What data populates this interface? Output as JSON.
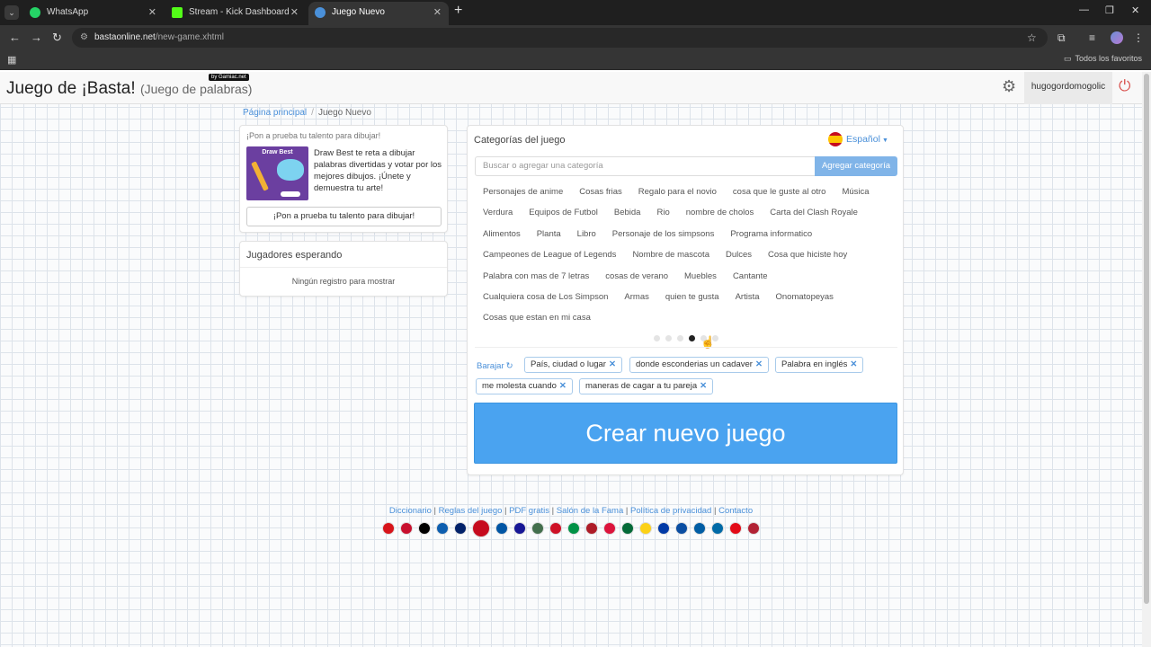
{
  "browser": {
    "tabs": [
      {
        "title": "WhatsApp",
        "icon": "whatsapp-icon",
        "color": "#25d366"
      },
      {
        "title": "Stream - Kick Dashboard",
        "icon": "kick-icon",
        "color": "#53fc18"
      },
      {
        "title": "Juego Nuevo",
        "icon": "globe-icon",
        "color": "#4a90d9"
      }
    ],
    "url_host": "bastaonline.net",
    "url_path": "/new-game.xhtml",
    "bookmarks_folder": "Todos los favoritos"
  },
  "header": {
    "title": "Juego de ¡Basta!",
    "subtitle": "(Juego de palabras)",
    "badge": "by Gamiac.net",
    "username": "hugogordomogolic"
  },
  "breadcrumb": {
    "home": "Página principal",
    "current": "Juego Nuevo"
  },
  "promo": {
    "heading": "¡Pon a prueba tu talento para dibujar!",
    "image_title": "Draw Best",
    "text": "Draw Best te reta a dibujar palabras divertidas y votar por los mejores dibujos. ¡Únete y demuestra tu arte!",
    "button": "¡Pon a prueba tu talento para dibujar!"
  },
  "waiting": {
    "title": "Jugadores esperando",
    "empty": "Ningún registro para mostrar"
  },
  "categories": {
    "title": "Categorías del juego",
    "language": "Español",
    "search_placeholder": "Buscar o agregar una categoría",
    "add_button": "Agregar categoría",
    "rows": [
      [
        "Personajes de anime",
        "Cosas frias",
        "Regalo para el novio",
        "cosa que le guste al otro",
        "Música"
      ],
      [
        "Verdura",
        "Equipos de Futbol",
        "Bebida",
        "Rio",
        "nombre de cholos",
        "Carta del Clash Royale"
      ],
      [
        "Alimentos",
        "Planta",
        "Libro",
        "Personaje de los simpsons",
        "Programa informatico"
      ],
      [
        "Campeones de League of Legends",
        "Nombre de mascota",
        "Dulces",
        "Cosa que hiciste hoy"
      ],
      [
        "Palabra con mas de 7 letras",
        "cosas de verano",
        "Muebles",
        "Cantante"
      ],
      [
        "Cualquiera cosa de Los Simpson",
        "Armas",
        "quien te gusta",
        "Artista",
        "Onomatopeyas"
      ],
      [
        "Cosas que estan en mi casa"
      ]
    ],
    "pages": 6,
    "active_page": 4,
    "shuffle": "Barajar",
    "selected": [
      "País, ciudad o lugar",
      "donde esconderias un cadaver",
      "Palabra en inglés",
      "me molesta cuando",
      "maneras de cagar a tu pareja"
    ],
    "create_button": "Crear nuevo juego"
  },
  "footer": {
    "links": [
      "Diccionario",
      "Reglas del juego",
      "PDF gratis",
      "Salón de la Fama",
      "Política de privacidad",
      "Contacto"
    ],
    "flag_colors": [
      "#d7141a",
      "#c8102e",
      "#000000",
      "#0d5eaf",
      "#012169",
      "#c60b1e",
      "#0055a4",
      "#171796",
      "#436f4d",
      "#ce1126",
      "#009246",
      "#ae1c28",
      "#dc143c",
      "#046a38",
      "#fcd116",
      "#0039a6",
      "#0b4ea2",
      "#005da4",
      "#006aa7",
      "#e30a17",
      "#b22234"
    ]
  }
}
